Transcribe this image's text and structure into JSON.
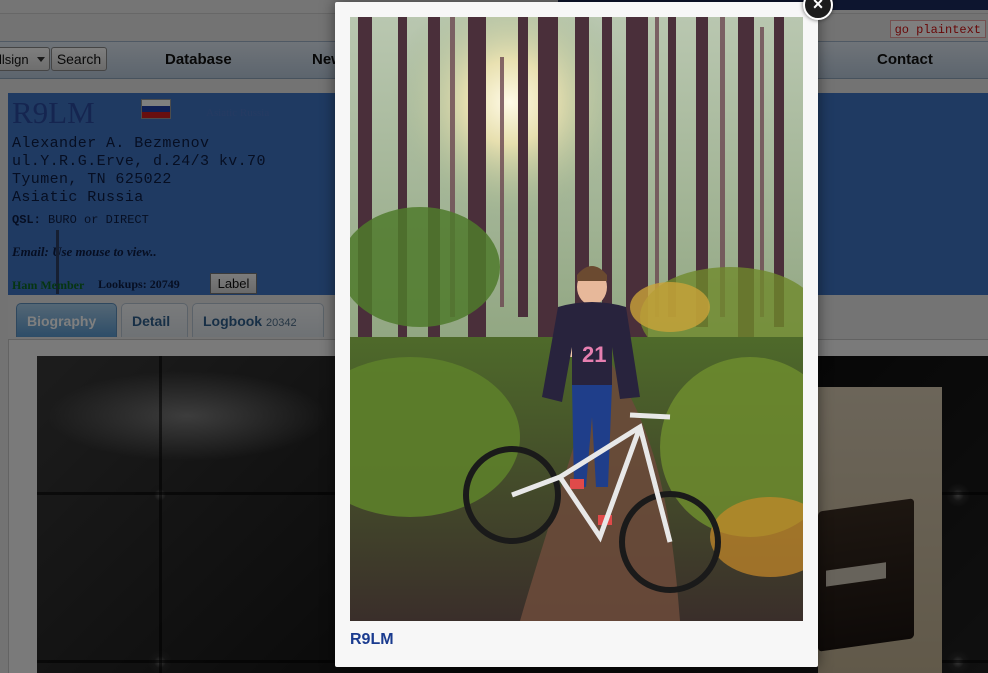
{
  "header": {
    "plaintext_link": "go plaintext"
  },
  "search": {
    "select_value": "llsign",
    "button_label": "Search"
  },
  "nav": {
    "items": [
      "Database",
      "New",
      "Contact"
    ]
  },
  "profile": {
    "callsign": "R9LM",
    "flag_country": "Asiatic Russia",
    "address_lines": [
      "Alexander A. Bezmenov",
      "ul.Y.R.G.Erve, d.24/3 kv.70",
      "Tyumen, TN 625022",
      "Asiatic Russia"
    ],
    "qsl_label": "QSL:",
    "qsl_value": "BURO or DIRECT",
    "email_text": "Email: Use mouse to view..",
    "ham_member": "Ham Member",
    "lookups_label": "Lookups:",
    "lookups_value": "20749",
    "label_button": "Label"
  },
  "tabs": [
    {
      "label": "Biography",
      "active": true
    },
    {
      "label": "Detail",
      "active": false
    },
    {
      "label": "Logbook",
      "count": "20342",
      "active": false
    }
  ],
  "lightbox": {
    "caption": "R9LM",
    "close_label": "×"
  },
  "colors": {
    "profile_band": "#3f74c4",
    "tab_active": "#5b9ad0",
    "caption_link": "#1a3b8f",
    "flag": [
      "#ffffff",
      "#1f3fa8",
      "#d11f1f"
    ]
  }
}
